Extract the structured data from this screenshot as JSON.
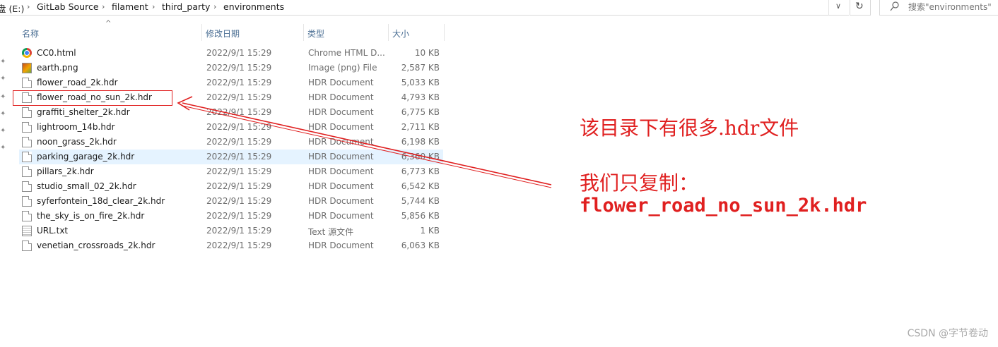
{
  "address_bar": {
    "breadcrumbs": [
      "盘 (E:)",
      "GitLab Source",
      "filament",
      "third_party",
      "environments"
    ]
  },
  "search": {
    "placeholder": "搜索\"environments\""
  },
  "columns": {
    "name": "名称",
    "date": "修改日期",
    "type": "类型",
    "size": "大小"
  },
  "files": [
    {
      "name": "CC0.html",
      "date": "2022/9/1 15:29",
      "type": "Chrome HTML D...",
      "size": "10 KB",
      "icon": "chrome-icon"
    },
    {
      "name": "earth.png",
      "date": "2022/9/1 15:29",
      "type": "Image (png) File",
      "size": "2,587 KB",
      "icon": "png-image-icon"
    },
    {
      "name": "flower_road_2k.hdr",
      "date": "2022/9/1 15:29",
      "type": "HDR Document",
      "size": "5,033 KB",
      "icon": "document-icon"
    },
    {
      "name": "flower_road_no_sun_2k.hdr",
      "date": "2022/9/1 15:29",
      "type": "HDR Document",
      "size": "4,793 KB",
      "icon": "document-icon"
    },
    {
      "name": "graffiti_shelter_2k.hdr",
      "date": "2022/9/1 15:29",
      "type": "HDR Document",
      "size": "6,775 KB",
      "icon": "document-icon"
    },
    {
      "name": "lightroom_14b.hdr",
      "date": "2022/9/1 15:29",
      "type": "HDR Document",
      "size": "2,711 KB",
      "icon": "document-icon"
    },
    {
      "name": "noon_grass_2k.hdr",
      "date": "2022/9/1 15:29",
      "type": "HDR Document",
      "size": "6,198 KB",
      "icon": "document-icon"
    },
    {
      "name": "parking_garage_2k.hdr",
      "date": "2022/9/1 15:29",
      "type": "HDR Document",
      "size": "6,360 KB",
      "icon": "document-icon",
      "selected": true
    },
    {
      "name": "pillars_2k.hdr",
      "date": "2022/9/1 15:29",
      "type": "HDR Document",
      "size": "6,773 KB",
      "icon": "document-icon"
    },
    {
      "name": "studio_small_02_2k.hdr",
      "date": "2022/9/1 15:29",
      "type": "HDR Document",
      "size": "6,542 KB",
      "icon": "document-icon"
    },
    {
      "name": "syferfontein_18d_clear_2k.hdr",
      "date": "2022/9/1 15:29",
      "type": "HDR Document",
      "size": "5,744 KB",
      "icon": "document-icon"
    },
    {
      "name": "the_sky_is_on_fire_2k.hdr",
      "date": "2022/9/1 15:29",
      "type": "HDR Document",
      "size": "5,856 KB",
      "icon": "document-icon"
    },
    {
      "name": "URL.txt",
      "date": "2022/9/1 15:29",
      "type": "Text 源文件",
      "size": "1 KB",
      "icon": "text-file-icon"
    },
    {
      "name": "venetian_crossroads_2k.hdr",
      "date": "2022/9/1 15:29",
      "type": "HDR Document",
      "size": "6,063 KB",
      "icon": "document-icon"
    }
  ],
  "annotation": {
    "line1": "该目录下有很多.hdr文件",
    "line2": "我们只复制：",
    "line3": "flower_road_no_sun_2k.hdr",
    "color": "#e02020"
  },
  "watermark": "CSDN @字节卷动"
}
